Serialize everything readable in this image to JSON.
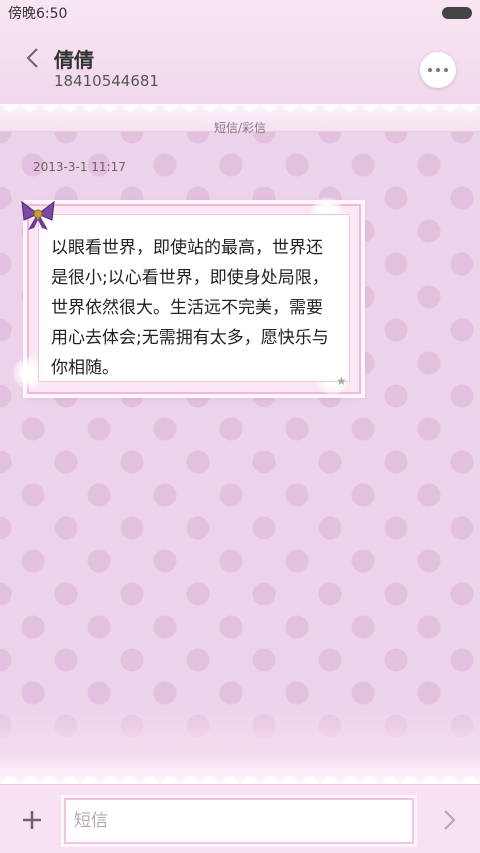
{
  "status_bar": {
    "time": "傍晚6:50"
  },
  "header": {
    "contact_name": "倩倩",
    "phone_number": "18410544681",
    "channel_label": "短信/彩信"
  },
  "conversation": {
    "messages": [
      {
        "timestamp": "2013-3-1 11:17",
        "text": "以眼看世界，即使站的最高，世界还是很小;以心看世界，即使身处局限，世界依然很大。生活远不完美，需要用心去体会;无需拥有太多，愿快乐与你相随。",
        "decoration_icon": "bow-icon"
      }
    ]
  },
  "composer": {
    "placeholder": "短信",
    "add_icon": "plus-icon",
    "send_icon": "chevron-right-icon"
  },
  "colors": {
    "background": "#edd3ea",
    "bubble_border": "#f0b9d8",
    "bow": "#7b4aa3"
  }
}
